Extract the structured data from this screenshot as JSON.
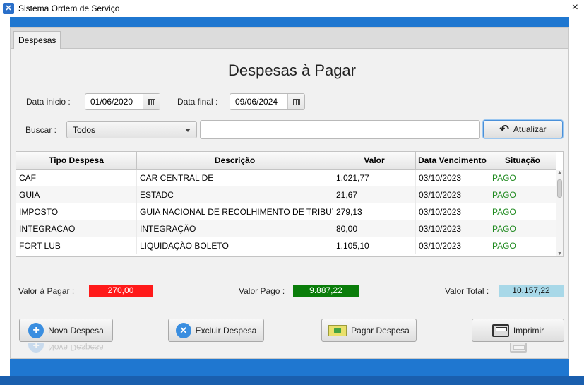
{
  "window": {
    "title": "Sistema Ordem de Serviço",
    "icon": "app-icon",
    "close": "×"
  },
  "tabs": [
    {
      "label": "Despesas"
    }
  ],
  "page_title": "Despesas à Pagar",
  "filters": {
    "start_label": "Data inicio :",
    "start_value": "01/06/2020",
    "end_label": "Data final :",
    "end_value": "09/06/2024",
    "search_label": "Buscar :",
    "search_option": "Todos",
    "search_text": "",
    "refresh_label": "Atualizar"
  },
  "table": {
    "columns": [
      "Tipo Despesa",
      "Descrição",
      "Valor",
      "Data Vencimento",
      "Situação"
    ],
    "rows": [
      [
        "CAF",
        "CAR CENTRAL DE",
        "1.021,77",
        "03/10/2023",
        "PAGO"
      ],
      [
        "GUIA",
        "ESTADC",
        "21,67",
        "03/10/2023",
        "PAGO"
      ],
      [
        "IMPOSTO",
        "GUIA NACIONAL DE RECOLHIMENTO DE TRIBUT...",
        "279,13",
        "03/10/2023",
        "PAGO"
      ],
      [
        "INTEGRACAO",
        "INTEGRAÇÃO",
        "80,00",
        "03/10/2023",
        "PAGO"
      ],
      [
        "FORT LUB",
        "LIQUIDAÇÃO BOLETO",
        "1.105,10",
        "03/10/2023",
        "PAGO"
      ]
    ]
  },
  "summary": {
    "to_pay_label": "Valor à Pagar :",
    "to_pay_value": "270,00",
    "paid_label": "Valor Pago :",
    "paid_value": "9.887,22",
    "total_label": "Valor Total :",
    "total_value": "10.157,22",
    "colors": {
      "to_pay": "#ff1a1a",
      "paid": "#0a7d0a",
      "total": "#a8d8e8"
    }
  },
  "actions": {
    "new_label": "Nova Despesa",
    "delete_label": "Excluir Despesa",
    "pay_label": "Pagar Despesa",
    "print_label": "Imprimir"
  }
}
